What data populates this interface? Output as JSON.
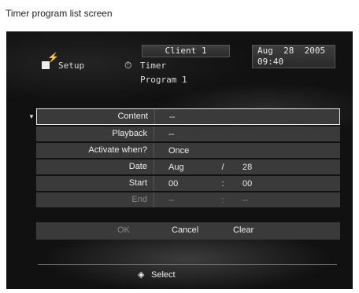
{
  "caption": "Timer program list screen",
  "header": {
    "client": "Client 1",
    "date": "Aug  28  2005",
    "time": "09:40",
    "setup": "Setup",
    "timer": "Timer",
    "program": "Program 1"
  },
  "rows": [
    {
      "label": "Content",
      "value": "--"
    },
    {
      "label": "Playback",
      "value": "--"
    },
    {
      "label": "Activate when?",
      "value": "Once"
    },
    {
      "label": "Date",
      "v1": "Aug",
      "sep": "/",
      "v2": "28"
    },
    {
      "label": "Start",
      "v1": "00",
      "sep": ":",
      "v2": "00"
    },
    {
      "label": "End",
      "v1": "--",
      "sep": ":",
      "v2": "--"
    }
  ],
  "buttons": {
    "ok": "OK",
    "cancel": "Cancel",
    "clear": "Clear"
  },
  "footer": {
    "select": "Select"
  },
  "icons": {
    "select_arrow": "down-triangle",
    "setup": "setup-icon",
    "timer": "timer-icon",
    "select_nav": "diamond-nav-icon"
  }
}
